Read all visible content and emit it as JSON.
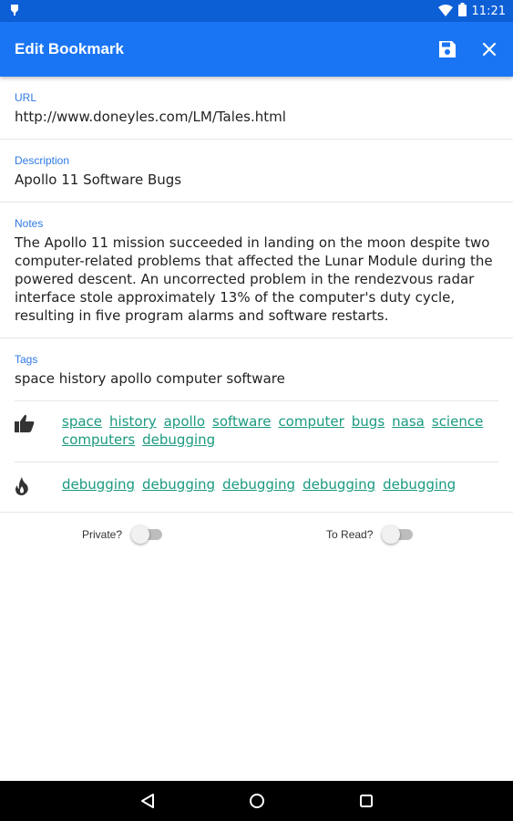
{
  "status_bar": {
    "time": "11:21",
    "icons": [
      "notification-icon",
      "wifi-icon",
      "battery-icon"
    ]
  },
  "app_bar": {
    "title": "Edit Bookmark",
    "background": "#1a75f5",
    "actions": [
      "save-icon",
      "close-icon"
    ]
  },
  "fields": {
    "url": {
      "label": "URL",
      "value": "http://www.doneyles.com/LM/Tales.html"
    },
    "description": {
      "label": "Description",
      "value": "Apollo 11 Software Bugs"
    },
    "notes": {
      "label": "Notes",
      "value": "The Apollo 11 mission succeeded in landing on the moon despite two computer-related problems that affected the Lunar Module during the powered descent. An uncorrected problem in the rendezvous radar interface stole approximately 13% of the computer's duty cycle, resulting in five program alarms and software restarts."
    },
    "tags": {
      "label": "Tags",
      "value": "space history apollo computer software"
    }
  },
  "suggested_tags": {
    "icon": "thumbs-up-icon",
    "items": [
      "space",
      "history",
      "apollo",
      "software",
      "computer",
      "bugs",
      "nasa",
      "science",
      "computers",
      "debugging"
    ]
  },
  "popular_tags": {
    "icon": "fire-icon",
    "items": [
      "debugging",
      "debugging",
      "debugging",
      "debugging",
      "debugging"
    ]
  },
  "toggles": {
    "private_label": "Private?",
    "to_read_label": "To Read?"
  },
  "colors": {
    "accent": "#2f7ae5",
    "tag": "#1a9a80"
  },
  "nav_bar": [
    "back-icon",
    "home-icon",
    "recents-icon"
  ]
}
